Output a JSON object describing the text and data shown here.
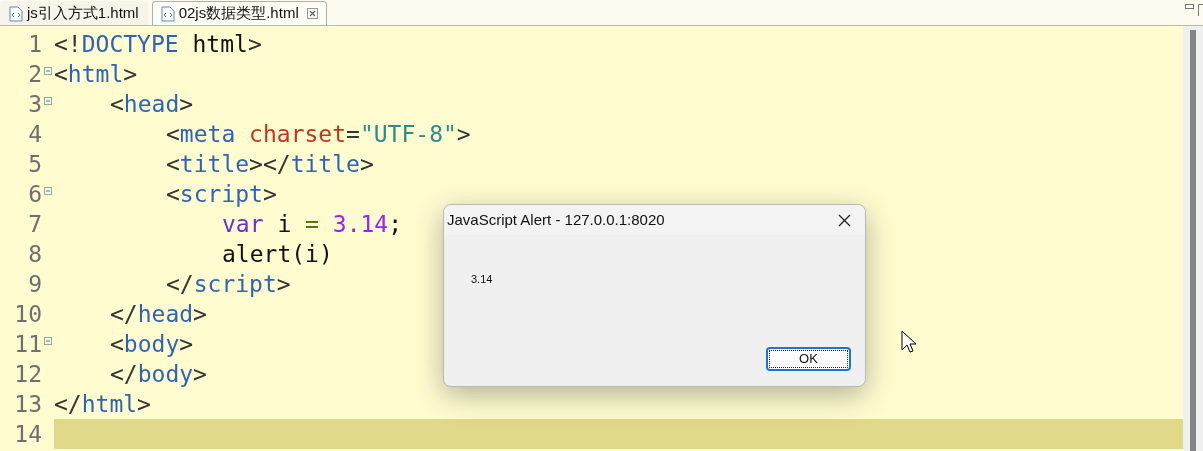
{
  "tabs": [
    {
      "label": "js引入方式1.html",
      "selected": false
    },
    {
      "label": "02js数据类型.html",
      "selected": true
    }
  ],
  "editor": {
    "lines": [
      {
        "number": "1",
        "foldable": false,
        "current": false,
        "tokens": [
          {
            "kind": "punct",
            "text": "<!"
          },
          {
            "kind": "tag",
            "text": "DOCTYPE"
          },
          {
            "kind": "plain",
            "text": " html"
          },
          {
            "kind": "punct",
            "text": ">"
          }
        ]
      },
      {
        "number": "2",
        "foldable": true,
        "current": false,
        "tokens": [
          {
            "kind": "punct",
            "text": "<"
          },
          {
            "kind": "tag",
            "text": "html"
          },
          {
            "kind": "punct",
            "text": ">"
          }
        ],
        "children": [
          {
            "number": "3",
            "foldable": true,
            "current": false,
            "tokens": [
              {
                "kind": "punct",
                "text": "<"
              },
              {
                "kind": "tag",
                "text": "head"
              },
              {
                "kind": "punct",
                "text": ">"
              }
            ],
            "children": [
              {
                "number": "4",
                "foldable": false,
                "current": false,
                "tokens": [
                  {
                    "kind": "punct",
                    "text": "<"
                  },
                  {
                    "kind": "tag",
                    "text": "meta"
                  },
                  {
                    "kind": "attr",
                    "text": " charset"
                  },
                  {
                    "kind": "punct",
                    "text": "="
                  },
                  {
                    "kind": "string",
                    "text": "\"UTF-8\""
                  },
                  {
                    "kind": "punct",
                    "text": ">"
                  }
                ]
              },
              {
                "number": "5",
                "foldable": false,
                "current": false,
                "tokens": [
                  {
                    "kind": "punct",
                    "text": "<"
                  },
                  {
                    "kind": "tag",
                    "text": "title"
                  },
                  {
                    "kind": "punct",
                    "text": "></"
                  },
                  {
                    "kind": "tag",
                    "text": "title"
                  },
                  {
                    "kind": "punct",
                    "text": ">"
                  }
                ]
              },
              {
                "number": "6",
                "foldable": true,
                "current": false,
                "tokens": [
                  {
                    "kind": "punct",
                    "text": "<"
                  },
                  {
                    "kind": "tag",
                    "text": "script"
                  },
                  {
                    "kind": "punct",
                    "text": ">"
                  }
                ],
                "children": [
                  {
                    "number": "7",
                    "foldable": false,
                    "current": false,
                    "tokens": [
                      {
                        "kind": "keyword",
                        "text": "var"
                      },
                      {
                        "kind": "plain",
                        "text": " i "
                      },
                      {
                        "kind": "operator",
                        "text": "="
                      },
                      {
                        "kind": "number",
                        "text": " 3.14"
                      },
                      {
                        "kind": "plain",
                        "text": ";"
                      }
                    ]
                  },
                  {
                    "number": "8",
                    "foldable": false,
                    "current": false,
                    "tokens": [
                      {
                        "kind": "plain",
                        "text": "alert(i)"
                      }
                    ]
                  }
                ]
              },
              {
                "number": "9",
                "foldable": false,
                "current": false,
                "tokens": [
                  {
                    "kind": "punct",
                    "text": "</"
                  },
                  {
                    "kind": "tag",
                    "text": "script"
                  },
                  {
                    "kind": "punct",
                    "text": ">"
                  }
                ]
              }
            ]
          },
          {
            "number": "10",
            "foldable": false,
            "current": false,
            "tokens": [
              {
                "kind": "punct",
                "text": "</"
              },
              {
                "kind": "tag",
                "text": "head"
              },
              {
                "kind": "punct",
                "text": ">"
              }
            ]
          },
          {
            "number": "11",
            "foldable": true,
            "current": false,
            "tokens": [
              {
                "kind": "punct",
                "text": "<"
              },
              {
                "kind": "tag",
                "text": "body"
              },
              {
                "kind": "punct",
                "text": ">"
              }
            ]
          },
          {
            "number": "12",
            "foldable": false,
            "current": false,
            "tokens": [
              {
                "kind": "punct",
                "text": "</"
              },
              {
                "kind": "tag",
                "text": "body"
              },
              {
                "kind": "punct",
                "text": ">"
              }
            ]
          }
        ]
      },
      {
        "number": "13",
        "foldable": false,
        "current": false,
        "tokens": [
          {
            "kind": "punct",
            "text": "</"
          },
          {
            "kind": "tag",
            "text": "html"
          },
          {
            "kind": "punct",
            "text": ">"
          }
        ]
      },
      {
        "number": "14",
        "foldable": false,
        "current": true
      }
    ]
  },
  "dialog": {
    "title": "JavaScript Alert - 127.0.0.1:8020",
    "message": "3.14",
    "button": "OK"
  }
}
